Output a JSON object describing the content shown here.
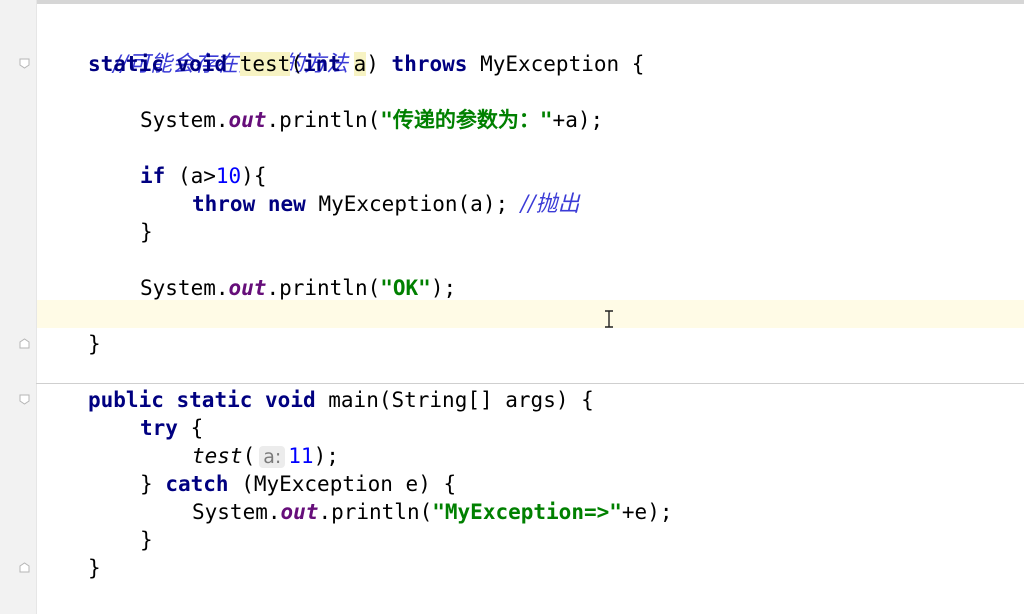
{
  "editor": {
    "lines": [
      {
        "text": "//可能会存在异常的方法"
      },
      {
        "kw1": "static",
        "kw2": "void",
        "method": "test",
        "paren_open": "(",
        "kw_int": "int",
        "param": "a",
        "paren_close": ")",
        "kw_throws": "throws",
        "type": "MyException",
        "brace": "{"
      },
      {
        "obj": "System.",
        "field": "out",
        "call": ".println(",
        "str": "\"传递的参数为：\"",
        "rest": "+a);"
      },
      {
        "kw": "if",
        "cond_open": " (a>",
        "num": "10",
        "cond_close": "){"
      },
      {
        "kw1": "throw",
        "kw2": "new",
        "ctor": "MyException(a);",
        "comment": "//抛出"
      },
      {
        "text": "}"
      },
      {
        "obj": "System.",
        "field": "out",
        "call": ".println(",
        "str": "\"OK\"",
        "rest": ");"
      },
      {
        "text": "}"
      },
      {
        "kw1": "public",
        "kw2": "static",
        "kw3": "void",
        "sig": "main(String[] args) {"
      },
      {
        "kw": "try",
        "brace": "{"
      },
      {
        "call": "test",
        "paren": "(",
        "hint": "a:",
        "num": "11",
        "rest": ");"
      },
      {
        "brace": "}",
        "kw": "catch",
        "rest": "(MyException e) {"
      },
      {
        "obj": "System.",
        "field": "out",
        "call": ".println(",
        "str": "\"MyException=>\"",
        "rest": "+e);"
      },
      {
        "text": "}"
      },
      {
        "text": "}"
      }
    ]
  },
  "icons": {
    "fold_marker": "fold-marker-icon",
    "text_cursor": "text-cursor-icon"
  }
}
